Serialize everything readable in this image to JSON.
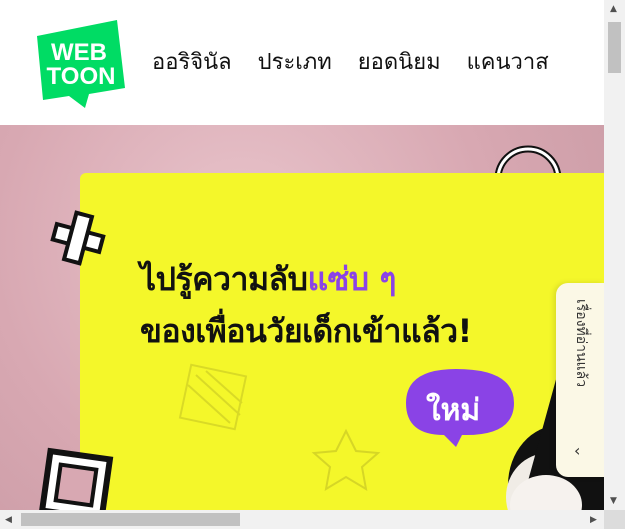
{
  "header": {
    "logo_line1": "WEB",
    "logo_line2": "TOON",
    "brand_color": "#00dc64",
    "nav": [
      "ออริจินัล",
      "ประเภท",
      "ยอดนิยม",
      "แคนวาส"
    ]
  },
  "banner": {
    "headline_line1_a": "ไปรู้ความลับ",
    "headline_line1_b": "แซ่บ ๆ",
    "headline_line2": "ของเพื่อนวัยเด็กเข้าแล้ว!",
    "new_badge": "ใหม่",
    "panel_color": "#f4f72a",
    "accent_color": "#8a43e6"
  },
  "side_tab": {
    "label": "เรื่องที่อ่านแล้ว",
    "chevron_icon": "chevron-left-icon"
  },
  "scrollbars": {
    "up_arrow_icon": "scroll-up-arrow-icon",
    "down_arrow_icon": "scroll-down-arrow-icon",
    "left_arrow_icon": "scroll-left-arrow-icon",
    "right_arrow_icon": "scroll-right-arrow-icon"
  }
}
